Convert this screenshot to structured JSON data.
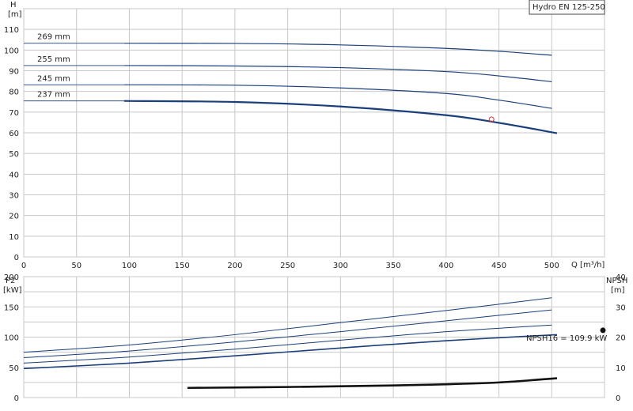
{
  "chart_data": [
    {
      "type": "line",
      "title_box": "Hydro EN 125-250",
      "ylabel": "H",
      "yunit": "[m]",
      "xlabel": "Q [m³/h]",
      "xlim": [
        0,
        550
      ],
      "ylim": [
        0,
        120
      ],
      "x_ticks": [
        "0",
        "50",
        "100",
        "150",
        "200",
        "250",
        "300",
        "350",
        "400",
        "450",
        "500"
      ],
      "y_ticks": [
        "0",
        "10",
        "20",
        "30",
        "40",
        "50",
        "60",
        "70",
        "80",
        "90",
        "100",
        "110"
      ],
      "grid": true,
      "series": [
        {
          "name": "269 mm",
          "x": [
            95,
            200,
            300,
            400,
            450,
            500
          ],
          "y": [
            103.3,
            103.2,
            102.5,
            100.8,
            99.4,
            97.5
          ]
        },
        {
          "name": "255 mm",
          "x": [
            95,
            200,
            300,
            400,
            450,
            500
          ],
          "y": [
            92.5,
            92.3,
            91.5,
            89.6,
            87.5,
            84.7
          ]
        },
        {
          "name": "245 mm",
          "x": [
            95,
            200,
            300,
            400,
            450,
            500
          ],
          "y": [
            83.2,
            83.0,
            81.7,
            79.0,
            75.8,
            71.8
          ]
        },
        {
          "name": "237 mm",
          "x": [
            95,
            200,
            300,
            400,
            450,
            505
          ],
          "y": [
            75.4,
            74.9,
            72.7,
            68.5,
            64.8,
            59.8
          ]
        }
      ],
      "operating_point": {
        "x": 443,
        "y": 66.5
      }
    },
    {
      "type": "line",
      "ylabel_left": "P2",
      "yunit_left": "[kW]",
      "ylabel_right": "NPSH",
      "yunit_right": "[m]",
      "xlim": [
        0,
        550
      ],
      "ylim_left": [
        0,
        200
      ],
      "ylim_right": [
        0,
        40
      ],
      "y_ticks_left": [
        "0",
        "50",
        "100",
        "150",
        "200"
      ],
      "y_ticks_right": [
        "0",
        "10",
        "20",
        "30",
        "40"
      ],
      "annotation": "NPSH16 = 109.9 kW",
      "power_series": [
        {
          "x": [
            0,
            100,
            200,
            300,
            400,
            500
          ],
          "y": [
            75,
            87,
            104,
            124,
            144,
            165
          ]
        },
        {
          "x": [
            0,
            100,
            200,
            300,
            400,
            500
          ],
          "y": [
            66,
            77,
            92,
            109,
            127,
            145
          ]
        },
        {
          "x": [
            0,
            100,
            200,
            300,
            400,
            500
          ],
          "y": [
            57,
            67,
            80,
            95,
            109,
            120
          ]
        },
        {
          "x": [
            0,
            100,
            200,
            300,
            400,
            505
          ],
          "y": [
            48,
            57,
            69,
            82,
            94,
            104
          ]
        }
      ],
      "npsh_series": {
        "x": [
          155,
          250,
          350,
          400,
          450,
          490,
          505
        ],
        "y": [
          3.2,
          3.5,
          4.0,
          4.4,
          5.0,
          6.0,
          6.4
        ]
      },
      "marker_point": {
        "x": 550,
        "y": 109.9
      }
    }
  ]
}
